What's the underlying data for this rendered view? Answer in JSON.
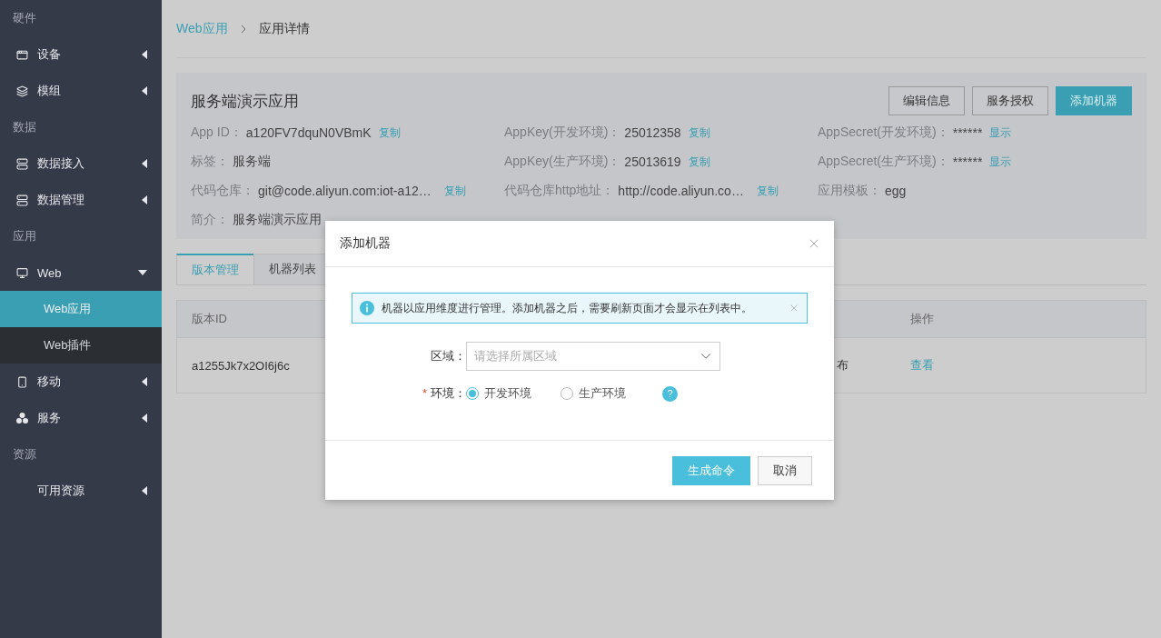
{
  "sidebar": {
    "sections": [
      {
        "header": "硬件",
        "items": [
          {
            "label": "设备",
            "expanded": false,
            "selected": false
          },
          {
            "label": "模组",
            "expanded": false,
            "selected": false
          }
        ]
      },
      {
        "header": "数据",
        "items": [
          {
            "label": "数据接入",
            "expanded": false,
            "selected": false
          },
          {
            "label": "数据管理",
            "expanded": false,
            "selected": false
          }
        ]
      },
      {
        "header": "应用",
        "items": [
          {
            "label": "Web",
            "expanded": true,
            "selected": false,
            "children": [
              {
                "label": "Web应用",
                "selected": true
              },
              {
                "label": "Web插件",
                "selected": false
              }
            ]
          },
          {
            "label": "移动",
            "expanded": false,
            "selected": false
          },
          {
            "label": "服务",
            "expanded": false,
            "selected": false
          }
        ]
      },
      {
        "header": "资源",
        "items": [
          {
            "label": "可用资源",
            "expanded": false,
            "selected": false
          }
        ]
      }
    ]
  },
  "breadcrumb": [
    {
      "label": "Web应用",
      "link": true
    },
    {
      "label": "应用详情",
      "link": false
    }
  ],
  "app_card": {
    "title": "服务端演示应用",
    "buttons": [
      {
        "label": "编辑信息",
        "primary": false
      },
      {
        "label": "服务授权",
        "primary": false
      },
      {
        "label": "添加机器",
        "primary": true
      }
    ],
    "rows": [
      [
        {
          "label": "App ID：",
          "value": "a120FV7dquN0VBmK",
          "action": "复制"
        },
        {
          "label": "AppKey(开发环境)：",
          "value": "25012358",
          "action": "复制"
        },
        {
          "label": "AppSecret(开发环境)：",
          "value": "******",
          "action": "显示"
        }
      ],
      [
        {
          "label": "标签：",
          "value": "服务端"
        },
        {
          "label": "AppKey(生产环境)：",
          "value": "25013619",
          "action": "复制"
        },
        {
          "label": "AppSecret(生产环境)：",
          "value": "******",
          "action": "显示"
        }
      ],
      [
        {
          "label": "代码仓库：",
          "value": "git@code.aliyun.com:iot-a12…",
          "action": "复制"
        },
        {
          "label": "代码仓库http地址：",
          "value": "http://code.aliyun.co…",
          "action": "复制"
        },
        {
          "label": "应用模板：",
          "value": "egg"
        }
      ],
      [
        {
          "label": "简介：",
          "value": "服务端演示应用"
        }
      ]
    ]
  },
  "tabs": [
    {
      "label": "版本管理",
      "selected": true
    },
    {
      "label": "机器列表",
      "selected": false
    }
  ],
  "table": {
    "columns": [
      "版本ID",
      "",
      "操作"
    ],
    "rows": [
      [
        "a1255Jk7x2OI6j6c",
        "布",
        "查看"
      ]
    ]
  },
  "dialog": {
    "title": "添加机器",
    "alert": "机器以应用维度进行管理。添加机器之后，需要刷新页面才会显示在列表中。",
    "region": {
      "label": "区域：",
      "placeholder": "请选择所属区域"
    },
    "environment": {
      "label": "环境：",
      "required_mark": "*",
      "options": [
        {
          "label": "开发环境",
          "selected": true
        },
        {
          "label": "生产环境",
          "selected": false
        }
      ],
      "help": "?"
    },
    "buttons": [
      {
        "label": "生成命令",
        "primary": true
      },
      {
        "label": "取消",
        "primary": false
      }
    ]
  }
}
